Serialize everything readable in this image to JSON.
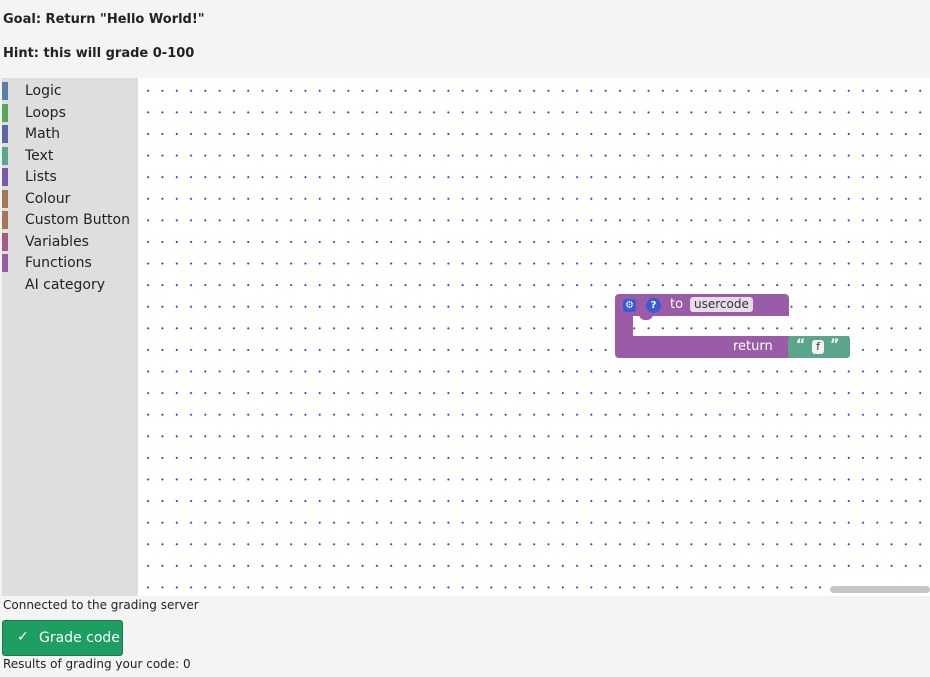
{
  "header": {
    "goal": "Goal: Return \"Hello World!\"",
    "hint": "Hint: this will grade 0-100"
  },
  "toolbox": {
    "items": [
      {
        "label": "Logic",
        "color": "#5b80a5"
      },
      {
        "label": "Loops",
        "color": "#5ba55b"
      },
      {
        "label": "Math",
        "color": "#5b67a5"
      },
      {
        "label": "Text",
        "color": "#5ba58c"
      },
      {
        "label": "Lists",
        "color": "#745ba5"
      },
      {
        "label": "Colour",
        "color": "#a5745b"
      },
      {
        "label": "Custom Button",
        "color": "#a5745b"
      },
      {
        "label": "Variables",
        "color": "#a55b80"
      },
      {
        "label": "Functions",
        "color": "#995ba5"
      },
      {
        "label": "AI category",
        "color": ""
      }
    ]
  },
  "canvas": {
    "function_block": {
      "gear_icon": "gear-icon",
      "help_icon": "?",
      "to_label": "to",
      "name": "usercode",
      "return_label": "return",
      "color": "#9a5ca6"
    },
    "text_block": {
      "open_quote": "“",
      "value": "f",
      "close_quote": "”",
      "color": "#5ba58c"
    }
  },
  "footer": {
    "status": "Connected to the grading server",
    "grade_button": "Grade code",
    "grade_icon": "check-icon",
    "results": "Results of grading your code: 0"
  }
}
